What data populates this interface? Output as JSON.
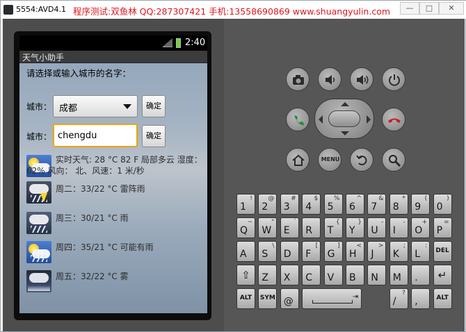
{
  "window": {
    "title": "5554:AVD4.1",
    "promo": "程序测试:双鱼林 QQ:287307421 手机:13558690869 www.shuangyulin.com",
    "controls": {
      "minimize": "—",
      "maximize": "□",
      "close": "✕"
    }
  },
  "status_bar": {
    "time": "2:40",
    "network_icon": "signal-3g-icon",
    "battery_icon": "battery-charging-icon"
  },
  "app": {
    "title": "天气小助手",
    "prompt": "请选择或输入城市的名字：",
    "city_label": "城市：",
    "spinner_value": "成都",
    "confirm_label": "确定",
    "input_value": "chengdu"
  },
  "weather": {
    "now_line1": "实时天气: 28 °C 82 F 局部多云 湿度：",
    "now_line2": "62% 风向： 北、风速：1 米/秒",
    "forecast": [
      {
        "text": "周二：33/22 °C 雷阵雨",
        "icon": "thunderstorm-icon"
      },
      {
        "text": "周三：30/21 °C 雨",
        "icon": "rain-icon"
      },
      {
        "text": "周四：35/21 °C 可能有雨",
        "icon": "chance-of-rain-icon"
      },
      {
        "text": "周五：32/22 °C 雾",
        "icon": "fog-icon"
      }
    ]
  },
  "controls": {
    "menu_label": "MENU"
  },
  "keyboard": {
    "row1": [
      [
        "1",
        "!"
      ],
      [
        "2",
        "@"
      ],
      [
        "3",
        "#"
      ],
      [
        "4",
        "$"
      ],
      [
        "5",
        "%"
      ],
      [
        "6",
        "^"
      ],
      [
        "7",
        "&"
      ],
      [
        "8",
        "*"
      ],
      [
        "9",
        "("
      ],
      [
        "0",
        ")"
      ]
    ],
    "row2": [
      [
        "Q",
        "~"
      ],
      [
        "W",
        "\""
      ],
      [
        "E",
        "´"
      ],
      [
        "R",
        ""
      ],
      [
        "T",
        "{"
      ],
      [
        "Y",
        "}"
      ],
      [
        "U",
        "-"
      ],
      [
        "I",
        "-"
      ],
      [
        "O",
        "+"
      ],
      [
        "P",
        "="
      ]
    ],
    "row3": [
      [
        "A",
        ""
      ],
      [
        "S",
        "\\"
      ],
      [
        "D",
        ""
      ],
      [
        "F",
        "["
      ],
      [
        "G",
        "]"
      ],
      [
        "H",
        "<"
      ],
      [
        "J",
        ">"
      ],
      [
        "K",
        ";"
      ],
      [
        "L",
        ":"
      ]
    ],
    "row4": [
      [
        "Z",
        ""
      ],
      [
        "X",
        ""
      ],
      [
        "C",
        ""
      ],
      [
        "V",
        ""
      ],
      [
        "B",
        ""
      ],
      [
        "N",
        ""
      ],
      [
        "M",
        ""
      ],
      [
        ".",
        ""
      ]
    ],
    "row5": {
      "alt": "ALT",
      "sym": "SYM",
      "at": "@",
      "slash": "/",
      "slash_sub": "?",
      "comma": ",",
      "del": "DEL"
    }
  }
}
